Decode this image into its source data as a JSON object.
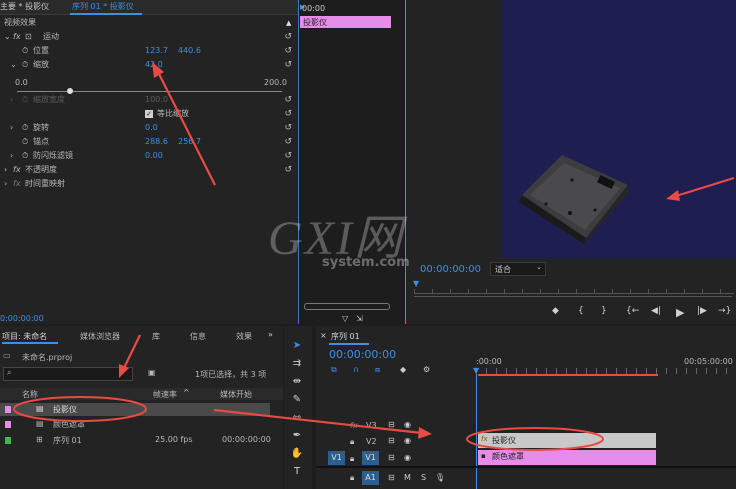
{
  "effect_controls": {
    "tab_main": "主要 * 投影仪",
    "tab_sequence": "序列 01 * 投影仪",
    "section": "视频效果",
    "motion": "运动",
    "position_label": "位置",
    "position_x": "123.7",
    "position_y": "440.6",
    "scale_label": "缩放",
    "scale_value": "42.0",
    "slider_min": "0.0",
    "slider_max": "200.0",
    "scale_width_label": "缩放宽度",
    "scale_width_value": "100.0",
    "uniform_scale_label": "等比缩放",
    "rotation_label": "旋转",
    "rotation_value": "0.0",
    "anchor_label": "锚点",
    "anchor_x": "288.6",
    "anchor_y": "256.7",
    "antiflicker_label": "防闪烁滤镜",
    "antiflicker_value": "0.00",
    "opacity_label": "不透明度",
    "time_remap_label": "时间重映射",
    "mini_timecode": "00:00",
    "mini_clip_label": "投影仪",
    "bottom_timecode": "0:00:00:00"
  },
  "program_monitor": {
    "timecode": "00:00:00:00",
    "fit_label": "适合"
  },
  "watermark": {
    "big": "GXI网",
    "small": "system.com"
  },
  "project": {
    "tab_project": "项目: 未命名",
    "tab_media": "媒体浏览器",
    "tab_library": "库",
    "tab_info": "信息",
    "tab_effects": "效果",
    "project_file": "未命名.prproj",
    "selection_info": "1项已选择，共 3 项",
    "col_name": "名称",
    "col_fps": "帧速率",
    "col_start": "媒体开始",
    "items": [
      {
        "name": "投影仪",
        "fps": "",
        "start": "",
        "color": "#e58be8"
      },
      {
        "name": "颜色遮罩",
        "fps": "",
        "start": "",
        "color": "#e58be8"
      },
      {
        "name": "序列 01",
        "fps": "25.00 fps",
        "start": "00:00:00:00",
        "color": "#3cb84a"
      }
    ]
  },
  "timeline": {
    "tab": "序列 01",
    "timecode": "00:00:00:00",
    "ruler_start": ":00:00",
    "ruler_end": "00:05:00:00",
    "tracks": [
      "V3",
      "V2",
      "V1",
      "A1"
    ],
    "source_v": "V1",
    "source_a": "A1",
    "clip_top": "投影仪",
    "clip_bottom": "颜色遮罩"
  }
}
